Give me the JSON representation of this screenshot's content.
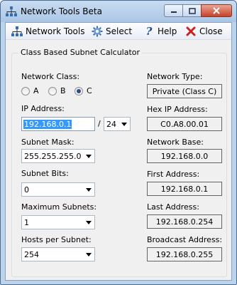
{
  "window": {
    "title": "Network Tools Beta"
  },
  "menu": {
    "network_tools": "Network Tools",
    "select": "Select",
    "help": "Help",
    "close": "Close"
  },
  "group": {
    "title": "Class Based Subnet Calculator"
  },
  "network_class": {
    "label": "Network Class:",
    "options": [
      "A",
      "B",
      "C"
    ],
    "selected": "C"
  },
  "ip_address": {
    "label": "IP Address:",
    "value": "192.168.0.1",
    "separator": "/",
    "cidr": "24"
  },
  "subnet_mask": {
    "label": "Subnet Mask:",
    "value": "255.255.255.0"
  },
  "subnet_bits": {
    "label": "Subnet Bits:",
    "value": "0"
  },
  "maximum_subnets": {
    "label": "Maximum Subnets:",
    "value": "1"
  },
  "hosts_per_subnet": {
    "label": "Hosts per Subnet:",
    "value": "254"
  },
  "results": {
    "network_type": {
      "label": "Network Type:",
      "value": "Private (Class C)"
    },
    "hex_ip": {
      "label": "Hex IP Address:",
      "value": "C0.A8.00.01"
    },
    "network_base": {
      "label": "Network Base:",
      "value": "192.168.0.0"
    },
    "first_address": {
      "label": "First Address:",
      "value": "192.168.0.1"
    },
    "last_address": {
      "label": "Last Address:",
      "value": "192.168.0.254"
    },
    "broadcast_address": {
      "label": "Broadcast Address:",
      "value": "192.168.0.255"
    }
  }
}
